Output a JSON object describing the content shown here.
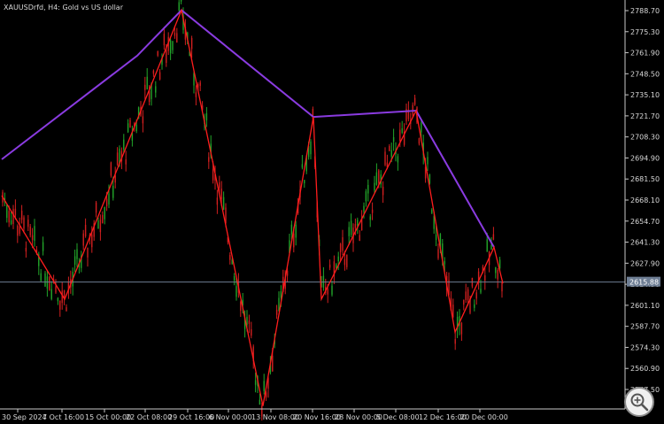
{
  "chart_title": "XAUUSDrfd, H4:  Gold vs US dollar",
  "colors": {
    "background": "#000000",
    "axis": "#c8c8c8",
    "text": "#d8d8d8",
    "bull_candle": "#22a52a",
    "bear_candle": "#d21f1f",
    "zigzag": "#ff1d1d",
    "upper_envelope": "#8a3be0",
    "price_line": "#6d7d93",
    "price_tag_bg": "#6d7d93",
    "zoom_bg": "#f0f0f0"
  },
  "icons": {
    "zoom": "magnifier-plus-icon"
  },
  "current_price_label": "2615.88",
  "chart_data": {
    "type": "candlestick",
    "symbol": "XAUUSDrfd",
    "timeframe": "H4",
    "description": "Gold vs US dollar",
    "y_ticks": [
      "2788.70",
      "2775.30",
      "2761.90",
      "2748.50",
      "2735.10",
      "2721.70",
      "2708.30",
      "2694.90",
      "2681.50",
      "2668.10",
      "2654.70",
      "2641.30",
      "2627.90",
      "2614.50",
      "2601.10",
      "2587.70",
      "2574.30",
      "2560.90",
      "2547.50"
    ],
    "x_ticks": [
      "30 Sep 2024",
      "7 Oct 16:00",
      "15 Oct 00:00",
      "22 Oct 08:00",
      "29 Oct 16:00",
      "6 Nov 00:00",
      "13 Nov 08:00",
      "20 Nov 16:00",
      "28 Nov 00:00",
      "5 Dec 08:00",
      "12 Dec 16:00",
      "20 Dec 00:00"
    ],
    "ylim": [
      2541,
      2791
    ],
    "current_price": 2615.88,
    "zigzag_points": [
      {
        "time": "30 Sep 2024",
        "price": 2671
      },
      {
        "time": "8 Oct",
        "price": 2605
      },
      {
        "time": "30 Oct",
        "price": 2789
      },
      {
        "time": "14 Nov",
        "price": 2537
      },
      {
        "time": "25 Nov",
        "price": 2721
      },
      {
        "time": "26 Nov",
        "price": 2605
      },
      {
        "time": "11 Dec",
        "price": 2725
      },
      {
        "time": "19 Dec",
        "price": 2584
      },
      {
        "time": "27 Dec",
        "price": 2638
      },
      {
        "time": "31 Dec",
        "price": 2615
      }
    ],
    "upper_envelope_points": [
      {
        "time": "30 Sep 2024",
        "price": 2694
      },
      {
        "time": "25 Oct",
        "price": 2760
      },
      {
        "time": "30 Oct",
        "price": 2789
      },
      {
        "time": "25 Nov",
        "price": 2721
      },
      {
        "time": "11 Dec",
        "price": 2725
      },
      {
        "time": "27 Dec",
        "price": 2638
      }
    ]
  }
}
